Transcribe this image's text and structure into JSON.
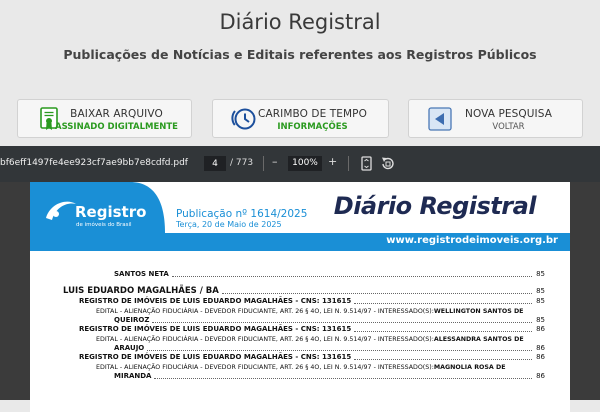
{
  "site": {
    "title": "Diário Registral",
    "subtitle": "Publicações de Notícias e Editais referentes aos Registros Públicos"
  },
  "actions": [
    {
      "label": "BAIXAR ARQUIVO",
      "sublabel": "ASSINADO DIGITALMENTE",
      "sublabel_color": "#2a9a1f",
      "icon": "certificate-icon"
    },
    {
      "label": "CARIMBO DE TEMPO",
      "sublabel": "INFORMAÇÕES",
      "sublabel_color": "#2a9a1f",
      "icon": "clock-icon"
    },
    {
      "label": "NOVA PESQUISA",
      "sublabel": "VOLTAR",
      "sublabel_color": "#555555",
      "icon": "back-arrow-icon"
    }
  ],
  "viewer": {
    "file_name": "bf6eff1497fe4ee923cf7ae9bb7e8cdfd.pdf",
    "current_page": "4",
    "total_pages": "/ 773",
    "zoom_out": "–",
    "zoom": "100%",
    "zoom_in": "+"
  },
  "document": {
    "logo_text": "Registro",
    "logo_sub": "de imóveis do Brasil",
    "publication": "Publicação nº 1614/2025",
    "date": "Terça, 20 de Maio de 2025",
    "brand": "Diário Registral",
    "url": "www.registrodeimoveis.org.br",
    "toc": [
      {
        "text": "SANTOS NETA",
        "page": "85"
      },
      {
        "text": "LUIS EDUARDO MAGALHÃES / BA",
        "page": "85"
      },
      {
        "text": "REGISTRO DE IMÓVEIS DE LUIS EDUARDO MAGALHÃES - CNS: 131615",
        "page": "85"
      },
      {
        "text": "EDITAL - ALIENAÇÃO FIDUCIÁRIA - DEVEDOR FIDUCIANTE, ART. 26 § 4O, LEI N. 9.514/97 - INTERESSADO(S): ",
        "bold": "WELLINGTON SANTOS DE",
        "page": ""
      },
      {
        "text": "QUEIROZ",
        "page": "85"
      },
      {
        "text": "REGISTRO DE IMÓVEIS DE LUIS EDUARDO MAGALHÃES - CNS: 131615",
        "page": "86"
      },
      {
        "text": "EDITAL - ALIENAÇÃO FIDUCIÁRIA - DEVEDOR FIDUCIANTE, ART. 26 § 4O, LEI N. 9.514/97 - INTERESSADO(S): ",
        "bold": "ALESSANDRA SANTOS DE",
        "page": ""
      },
      {
        "text": "ARAUJO",
        "page": "86"
      },
      {
        "text": "REGISTRO DE IMÓVEIS DE LUIS EDUARDO MAGALHÃES - CNS: 131615",
        "page": "86"
      },
      {
        "text": "EDITAL - ALIENAÇÃO FIDUCIÁRIA - DEVEDOR FIDUCIANTE, ART. 26 § 4O, LEI N. 9.514/97 - INTERESSADO(S): ",
        "bold": "MAGNOLIA ROSA DE",
        "page": ""
      },
      {
        "text": "MIRANDA",
        "page": "86"
      }
    ]
  }
}
